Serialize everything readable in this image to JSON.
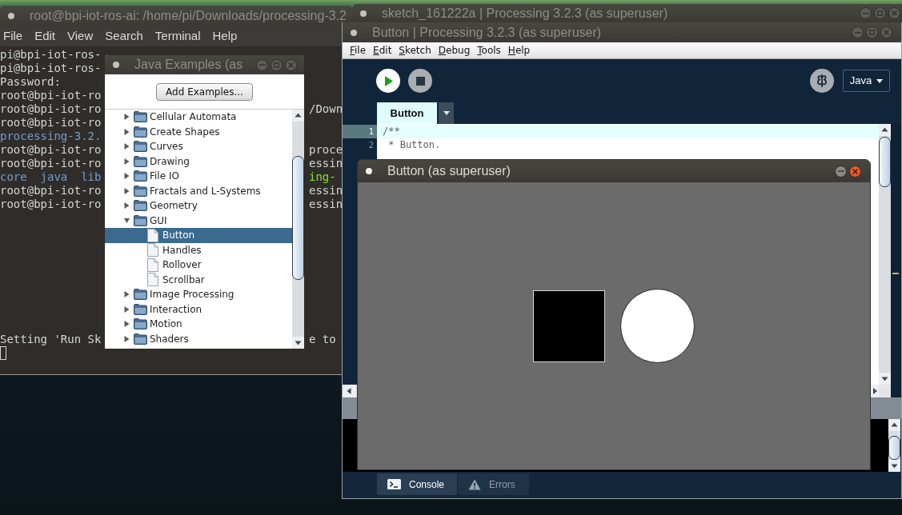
{
  "terminal": {
    "title": "root@bpi-iot-ros-ai: /home/pi/Downloads/processing-3.2",
    "active": false,
    "menu": [
      "File",
      "Edit",
      "View",
      "Search",
      "Terminal",
      "Help"
    ],
    "upper_lines": [
      {
        "left": {
          "text": "pi@bpi-iot-ros-",
          "color": "#d3d7cf"
        }
      },
      {
        "left": {
          "text": "pi@bpi-iot-ros-",
          "color": "#d3d7cf"
        }
      },
      {
        "left": {
          "text": "Password:",
          "color": "#d3d7cf"
        }
      },
      {
        "left": {
          "text": "root@bpi-iot-ro",
          "color": "#d3d7cf"
        }
      },
      {
        "left": {
          "text": "root@bpi-iot-ro",
          "color": "#d3d7cf"
        },
        "right": {
          "text": "/Down",
          "color": "#d3d7cf"
        }
      },
      {
        "left": {
          "text": "root@bpi-iot-ro",
          "color": "#d3d7cf"
        }
      },
      {
        "left": {
          "text": "processing-3.2.",
          "color": "#729fcf"
        }
      },
      {
        "left": {
          "text": "root@bpi-iot-ro",
          "color": "#d3d7cf"
        },
        "right": {
          "text": "proce",
          "color": "#d3d7cf"
        }
      },
      {
        "left": {
          "text": "root@bpi-iot-ro",
          "color": "#d3d7cf"
        },
        "right": {
          "text": "essin",
          "color": "#d3d7cf"
        }
      },
      {
        "left": {
          "text": "core  java  lib",
          "color": "#729fcf"
        },
        "right": {
          "text": "ing-",
          "color": "#8ae234"
        }
      },
      {
        "left": {
          "text": "root@bpi-iot-ro",
          "color": "#d3d7cf"
        },
        "right": {
          "text": "essin",
          "color": "#d3d7cf"
        }
      },
      {
        "left": {
          "text": "root@bpi-iot-ro",
          "color": "#d3d7cf"
        },
        "right": {
          "text": "essin",
          "color": "#d3d7cf"
        }
      }
    ],
    "lower_lines": [
      {
        "left": {
          "text": "Setting 'Run Sk",
          "color": "#d3d7cf"
        },
        "right": {
          "text": "e to",
          "color": "#d3d7cf"
        }
      }
    ]
  },
  "examples_dialog": {
    "title": "Java Examples (as",
    "active": false,
    "title_buttons": [
      {
        "kind": "minimize"
      },
      {
        "kind": "maximize"
      },
      {
        "kind": "close"
      }
    ],
    "add_button": "Add Examples...",
    "tree": [
      {
        "label": "Cellular Automata",
        "kind": "folder",
        "expanded": false,
        "selected": false
      },
      {
        "label": "Create Shapes",
        "kind": "folder",
        "expanded": false,
        "selected": false
      },
      {
        "label": "Curves",
        "kind": "folder",
        "expanded": false,
        "selected": false
      },
      {
        "label": "Drawing",
        "kind": "folder",
        "expanded": false,
        "selected": false
      },
      {
        "label": "File IO",
        "kind": "folder",
        "expanded": false,
        "selected": false
      },
      {
        "label": "Fractals and L-Systems",
        "kind": "folder",
        "expanded": false,
        "selected": false
      },
      {
        "label": "Geometry",
        "kind": "folder",
        "expanded": false,
        "selected": false
      },
      {
        "label": "GUI",
        "kind": "folder",
        "expanded": true,
        "selected": false,
        "children": [
          {
            "label": "Button",
            "kind": "file",
            "selected": true
          },
          {
            "label": "Handles",
            "kind": "file",
            "selected": false
          },
          {
            "label": "Rollover",
            "kind": "file",
            "selected": false
          },
          {
            "label": "Scrollbar",
            "kind": "file",
            "selected": false
          }
        ]
      },
      {
        "label": "Image Processing",
        "kind": "folder",
        "expanded": false,
        "selected": false
      },
      {
        "label": "Interaction",
        "kind": "folder",
        "expanded": false,
        "selected": false
      },
      {
        "label": "Motion",
        "kind": "folder",
        "expanded": false,
        "selected": false
      },
      {
        "label": "Shaders",
        "kind": "folder",
        "expanded": false,
        "selected": false
      }
    ]
  },
  "background_window": {
    "title": "sketch_161222a | Processing 3.2.3 (as superuser)",
    "active": false,
    "title_buttons": [
      {
        "kind": "minimize"
      },
      {
        "kind": "maximize"
      },
      {
        "kind": "close"
      }
    ]
  },
  "editor_window": {
    "title": "Button | Processing 3.2.3 (as superuser)",
    "active": false,
    "title_buttons": [
      {
        "kind": "minimize"
      },
      {
        "kind": "maximize"
      },
      {
        "kind": "close"
      }
    ],
    "menu": [
      "File",
      "Edit",
      "Sketch",
      "Debug",
      "Tools",
      "Help"
    ],
    "toolbar": {
      "running": true,
      "mode": "Java"
    },
    "tabs": [
      {
        "label": "Button",
        "selected": true
      }
    ],
    "code_lines": [
      {
        "number": "1",
        "text": "/**",
        "current": true
      },
      {
        "number": "2",
        "text": " * Button.",
        "current": false
      }
    ],
    "panel_tabs": [
      {
        "label": "Console",
        "kind": "console",
        "selected": true
      },
      {
        "label": "Errors",
        "kind": "errors",
        "selected": false
      }
    ]
  },
  "sketch_window": {
    "title": "Button (as superuser)",
    "active": true,
    "title_buttons": [
      {
        "kind": "minimize"
      },
      {
        "kind": "close"
      }
    ],
    "shapes": [
      {
        "kind": "square"
      },
      {
        "kind": "circle"
      }
    ]
  }
}
